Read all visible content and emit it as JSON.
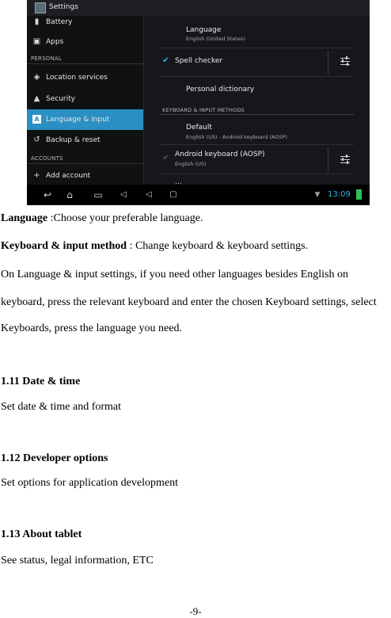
{
  "screenshot": {
    "app_title": "Settings",
    "sidebar": {
      "battery": "Battery",
      "apps": "Apps",
      "personal_header": "PERSONAL",
      "location": "Location services",
      "security": "Security",
      "language": "Language & input",
      "backup": "Backup & reset",
      "accounts_header": "ACCOUNTS",
      "add_account": "Add account"
    },
    "detail": {
      "language_title": "Language",
      "language_sub": "English (United States)",
      "spell_checker": "Spell checker",
      "personal_dictionary": "Personal dictionary",
      "keyboard_header": "KEYBOARD & INPUT METHODS",
      "default_title": "Default",
      "default_sub": "English (US) - Android keyboard (AOSP)",
      "android_keyboard": "Android keyboard (AOSP)",
      "android_keyboard_sub": "English (US)"
    },
    "status": {
      "clock": "13:09"
    },
    "accent_color": "#2a8fc2"
  },
  "doc": {
    "line1_term": "Language",
    "line1_rest": " :Choose your preferable language.",
    "line2_term": "Keyboard & input method",
    "line2_rest": " : Change keyboard & keyboard settings.",
    "body1": "On Language & input settings, if you need other languages besides English on",
    "body2": "keyboard, press the relevant keyboard and enter the chosen Keyboard settings, select",
    "body3": "Keyboards, press the language you need.",
    "h_date": "1.11 Date & time",
    "p_date": "Set date & time and format",
    "h_dev": "1.12 Developer options",
    "p_dev": "Set options for application development",
    "h_about": "1.13 About tablet",
    "p_about": "See status, legal information, ETC",
    "page_number": "-9-"
  }
}
